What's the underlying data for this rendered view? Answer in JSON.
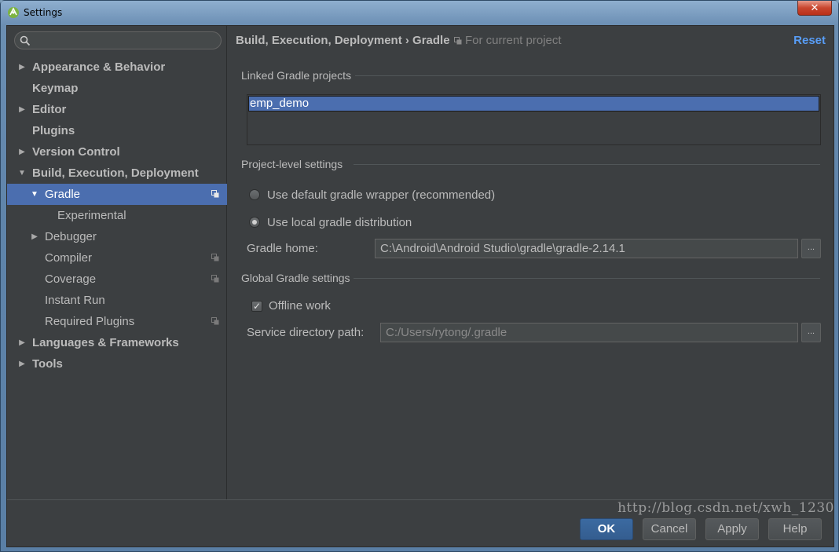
{
  "window": {
    "title": "Settings",
    "close_glyph": "✕"
  },
  "search": {
    "placeholder": "",
    "value": ""
  },
  "sidebar": {
    "items": [
      {
        "label": "Appearance & Behavior",
        "arrow": "▶",
        "bold": true,
        "level": 0
      },
      {
        "label": "Keymap",
        "arrow": "",
        "bold": true,
        "level": 0
      },
      {
        "label": "Editor",
        "arrow": "▶",
        "bold": true,
        "level": 0
      },
      {
        "label": "Plugins",
        "arrow": "",
        "bold": true,
        "level": 0
      },
      {
        "label": "Version Control",
        "arrow": "▶",
        "bold": true,
        "level": 0
      },
      {
        "label": "Build, Execution, Deployment",
        "arrow": "▼",
        "bold": true,
        "level": 0
      },
      {
        "label": "Gradle",
        "arrow": "▼",
        "bold": false,
        "level": 1,
        "selected": true,
        "project_icon": true
      },
      {
        "label": "Experimental",
        "arrow": "",
        "bold": false,
        "level": 2
      },
      {
        "label": "Debugger",
        "arrow": "▶",
        "bold": false,
        "level": 1
      },
      {
        "label": "Compiler",
        "arrow": "",
        "bold": false,
        "level": 1,
        "project_icon": true
      },
      {
        "label": "Coverage",
        "arrow": "",
        "bold": false,
        "level": 1,
        "project_icon": true
      },
      {
        "label": "Instant Run",
        "arrow": "",
        "bold": false,
        "level": 1
      },
      {
        "label": "Required Plugins",
        "arrow": "",
        "bold": false,
        "level": 1,
        "project_icon": true
      },
      {
        "label": "Languages & Frameworks",
        "arrow": "▶",
        "bold": true,
        "level": 0
      },
      {
        "label": "Tools",
        "arrow": "▶",
        "bold": true,
        "level": 0
      }
    ]
  },
  "header": {
    "breadcrumb": "Build, Execution, Deployment › Gradle",
    "scope": "For current project",
    "reset": "Reset"
  },
  "linked_projects": {
    "title": "Linked Gradle projects",
    "items": [
      "emp_demo"
    ]
  },
  "project_settings": {
    "title": "Project-level settings",
    "option_default": "Use default gradle wrapper (recommended)",
    "option_local": "Use local gradle distribution",
    "selected_option": "local",
    "gradle_home_label": "Gradle home:",
    "gradle_home_value": "C:\\Android\\Android Studio\\gradle\\gradle-2.14.1",
    "browse_label": "..."
  },
  "global_settings": {
    "title": "Global Gradle settings",
    "offline_work_label": "Offline work",
    "offline_work_checked": true,
    "service_dir_label": "Service directory path:",
    "service_dir_value": "C:/Users/rytong/.gradle",
    "browse_label": "..."
  },
  "buttons": {
    "ok": "OK",
    "cancel": "Cancel",
    "apply": "Apply",
    "help": "Help"
  },
  "watermark": "http://blog.csdn.net/xwh_1230",
  "colors": {
    "background": "#3c3f41",
    "selection": "#4b6eaf",
    "link": "#589df6",
    "text": "#bbbbbb"
  }
}
